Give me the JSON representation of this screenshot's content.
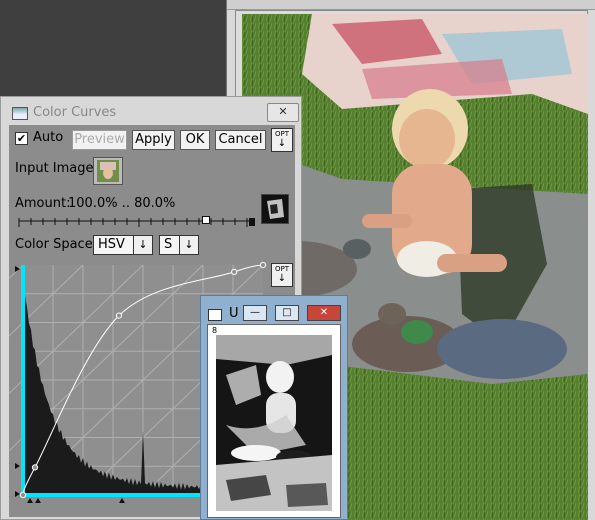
{
  "color_curves": {
    "title": "Color Curves",
    "auto_label": "Auto",
    "auto_checked": true,
    "buttons": {
      "preview": "Preview",
      "apply": "Apply",
      "ok": "OK",
      "cancel": "Cancel"
    },
    "opt_label": "OPT",
    "input_image_label": "Input Image:",
    "amount_label": "Amount:",
    "amount_value": "100.0% .. 80.0%",
    "color_space_label": "Color Space:",
    "color_space_value": "HSV",
    "channel_value": "S",
    "curve_points": [
      [
        0,
        0
      ],
      [
        0.05,
        0.12
      ],
      [
        0.4,
        0.78
      ],
      [
        0.88,
        0.97
      ],
      [
        1,
        1
      ]
    ]
  },
  "u_window": {
    "title": "U",
    "zoom_label": "8",
    "buttons": {
      "minimize": "—",
      "maximize": "□",
      "close": "✕"
    }
  },
  "icons": {
    "checkbox": "check-icon",
    "dropdown": "chevron-down-icon",
    "close": "close-icon"
  },
  "colors": {
    "curve_accent": "#00e5ff",
    "close_button": "#c8453a"
  }
}
